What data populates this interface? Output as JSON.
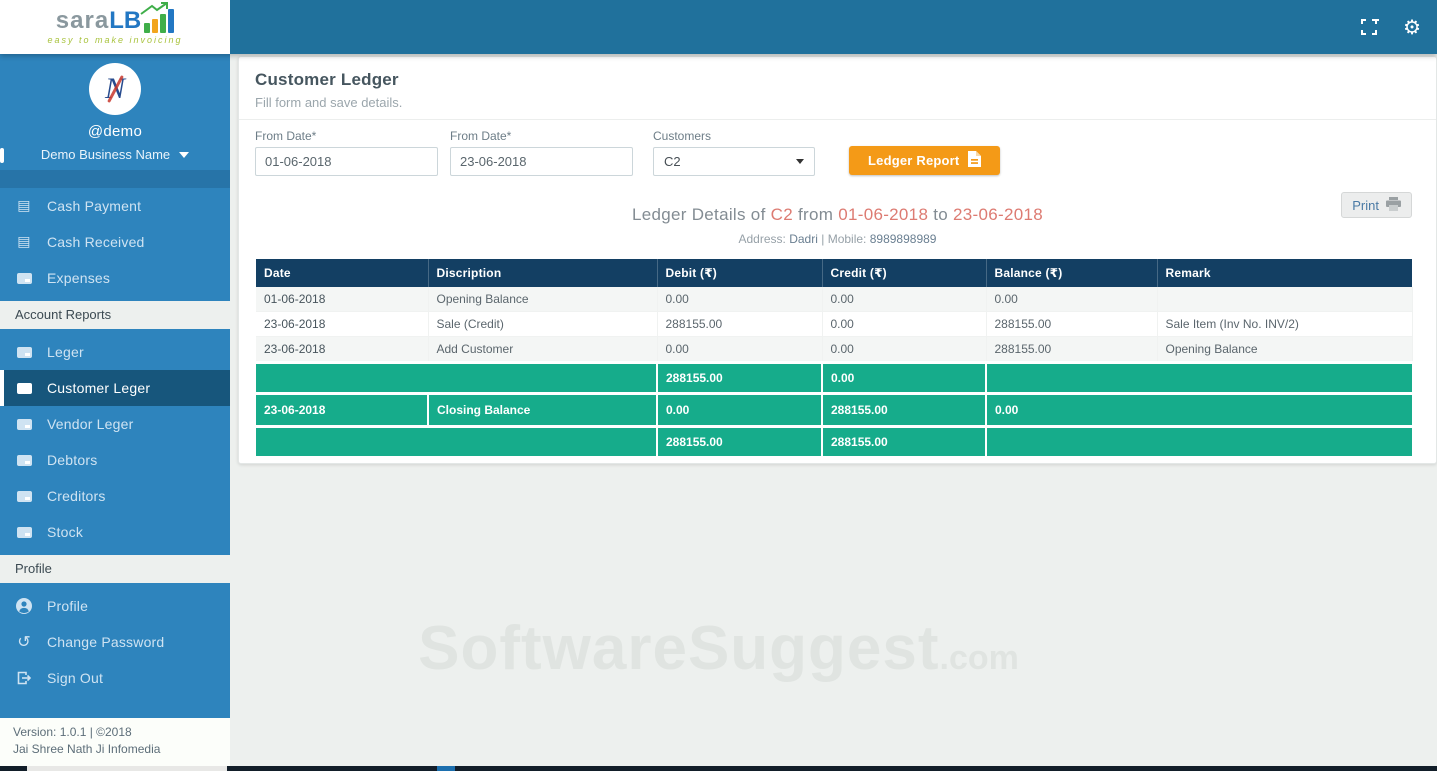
{
  "brand": {
    "name_left": "sara",
    "name_right": "LB",
    "tagline": "easy to make invoicing"
  },
  "sidebar": {
    "handle": "@demo",
    "business_name": "Demo Business Name",
    "avatar_monogram": "N",
    "menu1": [
      {
        "label": "Cash Payment"
      },
      {
        "label": "Cash Received"
      },
      {
        "label": "Expenses"
      }
    ],
    "section1": "Account Reports",
    "menu2": [
      {
        "label": "Leger"
      },
      {
        "label": "Customer Leger"
      },
      {
        "label": "Vendor Leger"
      },
      {
        "label": "Debtors"
      },
      {
        "label": "Creditors"
      },
      {
        "label": "Stock"
      }
    ],
    "section2": "Profile",
    "menu3": [
      {
        "label": "Profile"
      },
      {
        "label": "Change Password"
      },
      {
        "label": "Sign Out"
      }
    ],
    "version_line": "Version: 1.0.1 | ©2018",
    "company_line": "Jai Shree Nath Ji Infomedia"
  },
  "main": {
    "title": "Customer Ledger",
    "subtitle": "Fill form and save details.",
    "form": {
      "from_label": "From Date*",
      "to_label": "From Date*",
      "customers_label": "Customers",
      "from_value": "01-06-2018",
      "to_value": "23-06-2018",
      "customer_selected": "C2",
      "button_label": "Ledger Report"
    },
    "report": {
      "heading_prefix": "Ledger Details of",
      "heading_customer": "C2",
      "heading_from_word": "from",
      "heading_from_date": "01-06-2018",
      "heading_to_word": "to",
      "heading_to_date": "23-06-2018",
      "address_label": "Address:",
      "address_value": "Dadri",
      "divider": "|",
      "mobile_label": "Mobile:",
      "mobile_value": "8989898989",
      "print_label": "Print"
    },
    "table": {
      "headers": [
        "Date",
        "Discription",
        "Debit (₹)",
        "Credit (₹)",
        "Balance (₹)",
        "Remark"
      ],
      "rows": [
        {
          "date": "01-06-2018",
          "description": "Opening Balance",
          "debit": "0.00",
          "credit": "0.00",
          "balance": "0.00",
          "remark": ""
        },
        {
          "date": "23-06-2018",
          "description": "Sale (Credit)",
          "debit": "288155.00",
          "credit": "0.00",
          "balance": "288155.00",
          "remark": "Sale Item (Inv No. INV/2)"
        },
        {
          "date": "23-06-2018",
          "description": "Add Customer",
          "debit": "0.00",
          "credit": "0.00",
          "balance": "288155.00",
          "remark": "Opening Balance"
        }
      ],
      "subtotal": {
        "debit": "288155.00",
        "credit": "0.00"
      },
      "closing": {
        "date": "23-06-2018",
        "description": "Closing Balance",
        "debit": "0.00",
        "credit": "288155.00",
        "balance": "0.00"
      },
      "total": {
        "debit": "288155.00",
        "credit": "288155.00"
      }
    },
    "watermark": {
      "text": "SoftwareSuggest",
      "suffix": ".com"
    }
  },
  "colors": {
    "topbar": "#20719c",
    "sidebar": "#2e84bd",
    "sidebar_active": "#17567c",
    "table_header": "#133f63",
    "green_row": "#16ac8b",
    "accent_orange": "#f49a17",
    "highlight_red": "#dd7b72"
  }
}
